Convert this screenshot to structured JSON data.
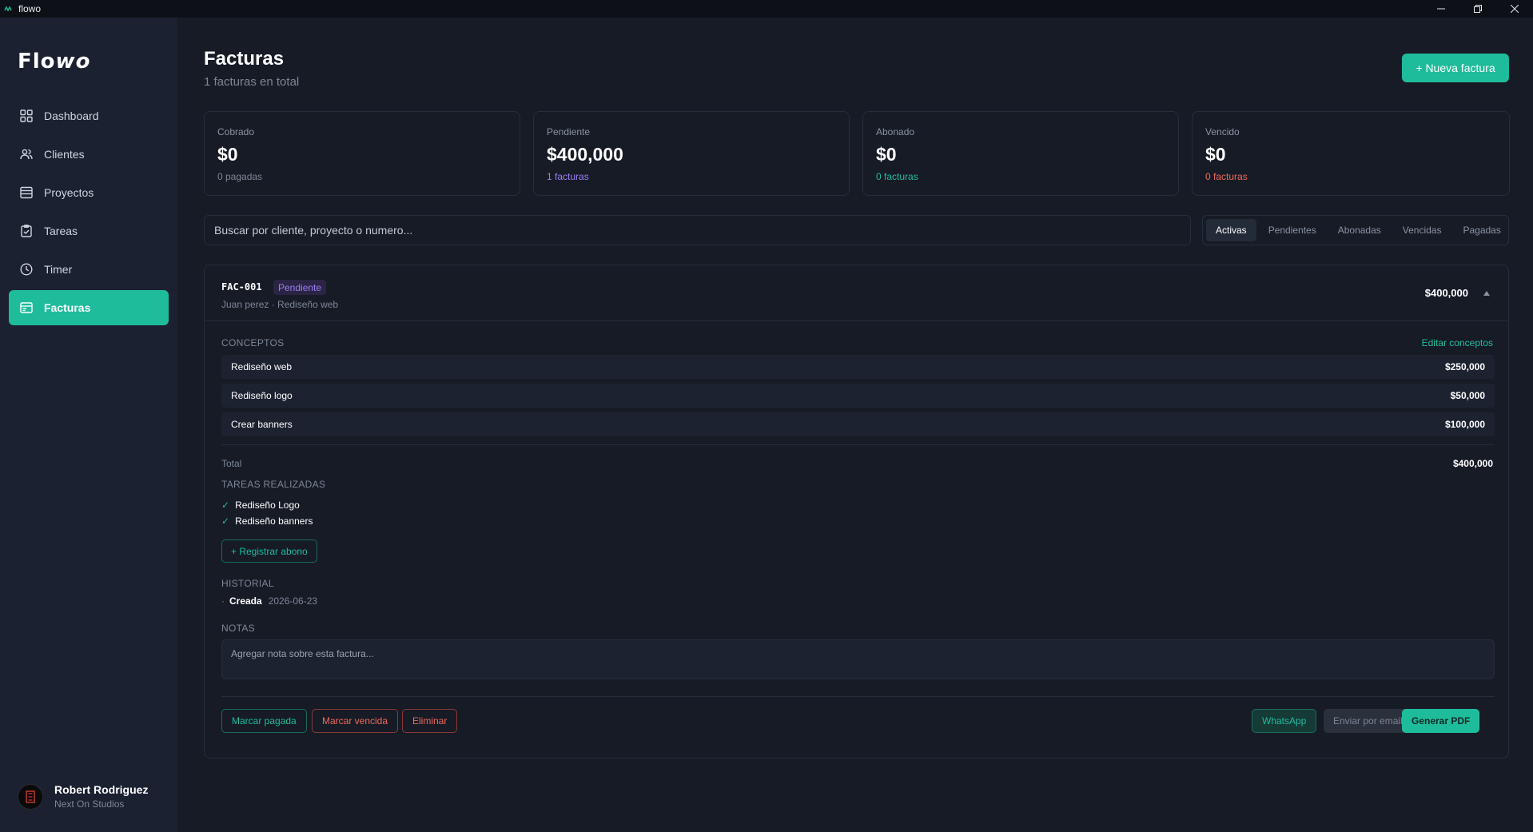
{
  "window": {
    "title": "flowo"
  },
  "sidebar": {
    "logo": {
      "prefix": "Flo",
      "accent": "wo"
    },
    "items": [
      {
        "label": "Dashboard",
        "icon": "grid-icon"
      },
      {
        "label": "Clientes",
        "icon": "users-icon"
      },
      {
        "label": "Proyectos",
        "icon": "list-icon"
      },
      {
        "label": "Tareas",
        "icon": "clipboard-check-icon"
      },
      {
        "label": "Timer",
        "icon": "clock-icon"
      },
      {
        "label": "Facturas",
        "icon": "invoice-icon",
        "active": true
      }
    ],
    "user": {
      "name": "Robert Rodriguez",
      "org": "Next On Studios"
    }
  },
  "header": {
    "title": "Facturas",
    "subtitle": "1 facturas en total",
    "new_button": "+ Nueva factura"
  },
  "stats": [
    {
      "label": "Cobrado",
      "value": "$0",
      "sub": "0 pagadas",
      "sub_color": "#7d8696"
    },
    {
      "label": "Pendiente",
      "value": "$400,000",
      "sub": "1 facturas",
      "sub_color": "#9d7ff2"
    },
    {
      "label": "Abonado",
      "value": "$0",
      "sub": "0 facturas",
      "sub_color": "#1fbc9c"
    },
    {
      "label": "Vencido",
      "value": "$0",
      "sub": "0 facturas",
      "sub_color": "#f06a5b"
    }
  ],
  "search": {
    "placeholder": "Buscar por cliente, proyecto o numero..."
  },
  "filters": [
    "Activas",
    "Pendientes",
    "Abonadas",
    "Vencidas",
    "Pagadas"
  ],
  "invoice": {
    "number": "FAC-001",
    "status": "Pendiente",
    "meta": "Juan perez · Rediseño web",
    "amount": "$400,000",
    "concepts_label": "CONCEPTOS",
    "edit_link": "Editar conceptos",
    "concepts": [
      {
        "name": "Rediseño web",
        "amount": "$250,000"
      },
      {
        "name": "Rediseño logo",
        "amount": "$50,000"
      },
      {
        "name": "Crear banners",
        "amount": "$100,000"
      }
    ],
    "total_label": "Total",
    "total_value": "$400,000",
    "tasks_label": "TAREAS REALIZADAS",
    "tasks": [
      "Rediseño Logo",
      "Rediseño banners"
    ],
    "abono_button": "+ Registrar abono",
    "history_label": "HISTORIAL",
    "history": [
      {
        "event": "Creada",
        "date": "2026-06-23"
      }
    ],
    "notes_label": "NOTAS",
    "notes_placeholder": "Agregar nota sobre esta factura...",
    "actions": {
      "paid": "Marcar pagada",
      "overdue": "Marcar vencida",
      "delete": "Eliminar",
      "whatsapp": "WhatsApp",
      "email": "Enviar por email",
      "pdf": "Generar PDF"
    }
  },
  "colors": {
    "accent": "#1fbc9c",
    "pending": "#9d7ff2",
    "danger": "#f06a5b"
  }
}
